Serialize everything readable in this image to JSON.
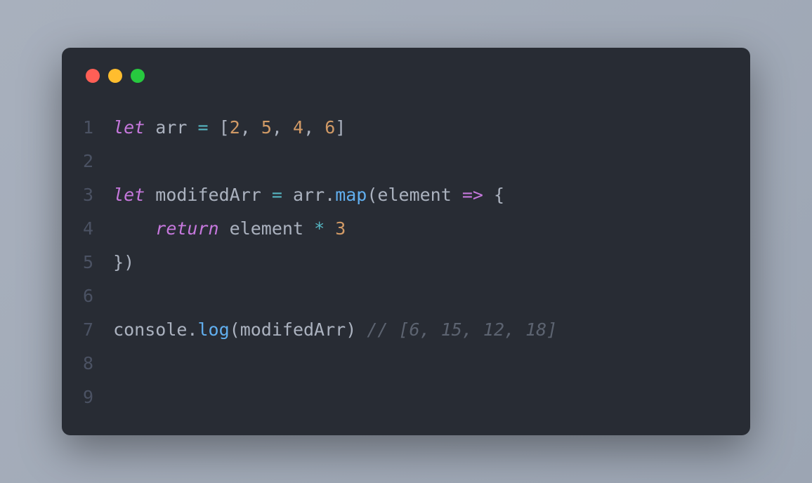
{
  "window": {
    "controls": [
      "close",
      "minimize",
      "maximize"
    ]
  },
  "code": {
    "lineNumbers": [
      "1",
      "2",
      "3",
      "4",
      "5",
      "6",
      "7",
      "8",
      "9"
    ],
    "lines": {
      "l1": {
        "let": "let",
        "sp1": " ",
        "arr": "arr",
        "sp2": " ",
        "eq": "=",
        "sp3": " ",
        "lb": "[",
        "n1": "2",
        "c1": ", ",
        "n2": "5",
        "c2": ", ",
        "n3": "4",
        "c3": ", ",
        "n4": "6",
        "rb": "]"
      },
      "l2": "",
      "l3": {
        "let": "let",
        "sp1": " ",
        "mod": "modifedArr",
        "sp2": " ",
        "eq": "=",
        "sp3": " ",
        "arr": "arr",
        "dot": ".",
        "map": "map",
        "lp": "(",
        "el": "element",
        "sp4": " ",
        "arrow": "=>",
        "sp5": " ",
        "lb": "{"
      },
      "l4": {
        "indent": "    ",
        "ret": "return",
        "sp1": " ",
        "el": "element",
        "sp2": " ",
        "mul": "*",
        "sp3": " ",
        "n": "3"
      },
      "l5": {
        "rb": "}",
        "rp": ")"
      },
      "l6": "",
      "l7": {
        "console": "console",
        "dot": ".",
        "log": "log",
        "lp": "(",
        "mod": "modifedArr",
        "rp": ")",
        "sp": " ",
        "comment": "// [6, 15, 12, 18]"
      },
      "l8": "",
      "l9": ""
    }
  }
}
